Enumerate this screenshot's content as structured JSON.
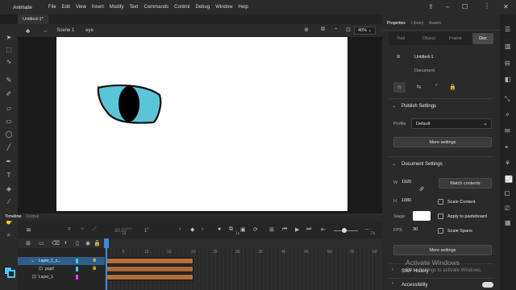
{
  "menubar": {
    "app_name": "Animate",
    "items": [
      "File",
      "Edit",
      "View",
      "Insert",
      "Modify",
      "Text",
      "Commands",
      "Control",
      "Debug",
      "Window",
      "Help"
    ]
  },
  "document": {
    "tab_label": "Untitled-1*"
  },
  "scenebar": {
    "scene": "Scene 1",
    "symbol": "eye",
    "zoom": "40%"
  },
  "timeline": {
    "tabs": [
      "Timeline",
      "Output"
    ],
    "fps": "30.00",
    "fps_unit": "FPS",
    "frame": "1",
    "frame_unit": "F",
    "ruler": [
      "5",
      "10",
      "15",
      "20",
      "25",
      "30",
      "35",
      "40",
      "45",
      "50",
      "55",
      "60"
    ],
    "ruler_top": [
      "1s",
      "2s"
    ],
    "layers": [
      {
        "name": "Layer_1_c...",
        "color": "#4fc3f7"
      },
      {
        "name": "pupil",
        "color": "#4fc3f7"
      },
      {
        "name": "Layer_1",
        "color": "#e040fb"
      }
    ]
  },
  "panel": {
    "tabs": [
      "Properties",
      "Library",
      "Assets"
    ],
    "subtabs": [
      "Tool",
      "Object",
      "Frame",
      "Doc"
    ],
    "doc_name": "Untitled-1",
    "doc_type": "Document",
    "publish": {
      "title": "Publish Settings",
      "profile_label": "Profile",
      "profile_value": "Default",
      "more_button": "More settings"
    },
    "doc_settings": {
      "title": "Document Settings",
      "w_label": "W",
      "w_value": "1920",
      "h_label": "H",
      "h_value": "1080",
      "match_button": "Match contents",
      "scale_content": "Scale Content",
      "stage_label": "Stage",
      "apply_pasteboard": "Apply to pasteboard",
      "fps_label": "FPS",
      "fps_value": "30",
      "scale_spans": "Scale Spans",
      "more_button": "More settings"
    },
    "swf_history": "SWF History",
    "accessibility": "Accessibility"
  },
  "watermark": {
    "line1": "Activate Windows",
    "line2": "Go to Settings to activate Windows."
  },
  "colors": {
    "accent": "#4fc3f7",
    "frame_span": "#b8703a",
    "stage": "#ffffff",
    "eye_fill": "#5bc4d8"
  }
}
